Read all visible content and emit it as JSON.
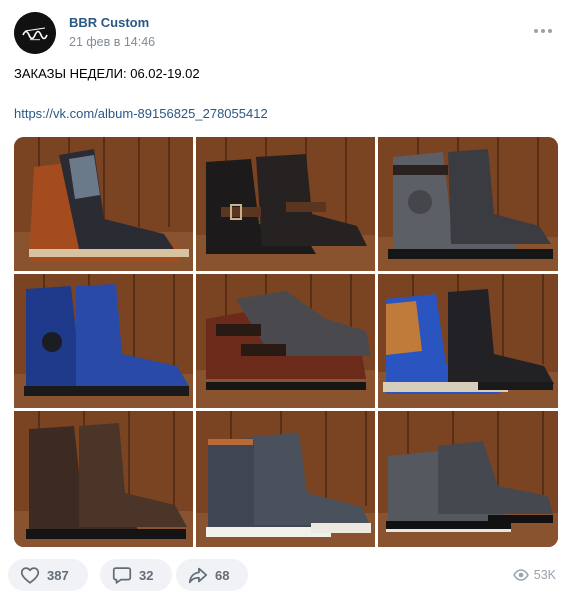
{
  "post": {
    "author": "BBR Custom",
    "date": "21 фев в 14:46",
    "text": "ЗАКАЗЫ НЕДЕЛИ: 06.02-19.02",
    "link": "https://vk.com/album-89156825_278055412",
    "avatar_icon": "bbr-logo-icon",
    "more_icon": "more-dots-icon"
  },
  "gallery": {
    "photos": [
      {
        "subject": "boot-photo-brown-laced"
      },
      {
        "subject": "boot-photo-black-buckle"
      },
      {
        "subject": "boot-photo-grey-black-buckle"
      },
      {
        "subject": "boot-photo-blue-laced"
      },
      {
        "subject": "boot-photo-brown-double-buckle"
      },
      {
        "subject": "boot-photo-blue-tan-black"
      },
      {
        "subject": "boot-photo-dark-brown-laced"
      },
      {
        "subject": "boot-photo-denim-white-sole"
      },
      {
        "subject": "boot-photo-grey-black-low"
      }
    ]
  },
  "actions": {
    "likes": "387",
    "comments": "32",
    "shares": "68",
    "views": "53K",
    "like_icon": "heart-icon",
    "comment_icon": "comment-icon",
    "share_icon": "share-arrow-icon",
    "views_icon": "eye-icon"
  },
  "colors": {
    "link": "#2a5885",
    "muted": "#818c99",
    "pill_bg": "#f0f2f5",
    "pill_text": "#626d7a"
  }
}
